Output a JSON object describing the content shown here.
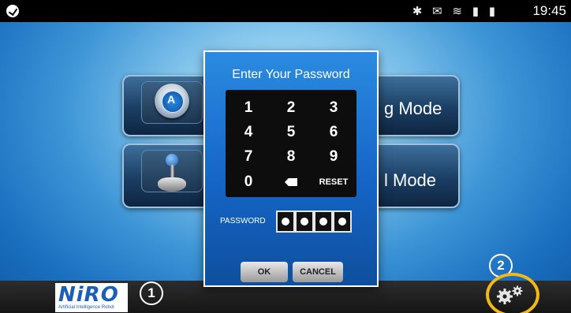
{
  "status_bar": {
    "icons": "✱ ✉ ≋ ▮ ▮",
    "time": "19:45"
  },
  "modes": [
    {
      "label": "g Mode"
    },
    {
      "label": "l Mode"
    }
  ],
  "dialog": {
    "title": "Enter Your Password",
    "keys": [
      "1",
      "2",
      "3",
      "4",
      "5",
      "6",
      "7",
      "8",
      "9",
      "0",
      "backspace",
      "RESET"
    ],
    "reset_label": "RESET",
    "password_label": "PASSWORD",
    "password_dots": 4,
    "ok_label": "OK",
    "cancel_label": "CANCEL"
  },
  "bottom_bar": {
    "logo_text": "NiRO",
    "logo_subtitle": "Artificial Intelligence Robot",
    "callout_1": "1",
    "callout_2": "2",
    "settings_icon": "gears-icon",
    "highlight_color": "#f2b817"
  }
}
